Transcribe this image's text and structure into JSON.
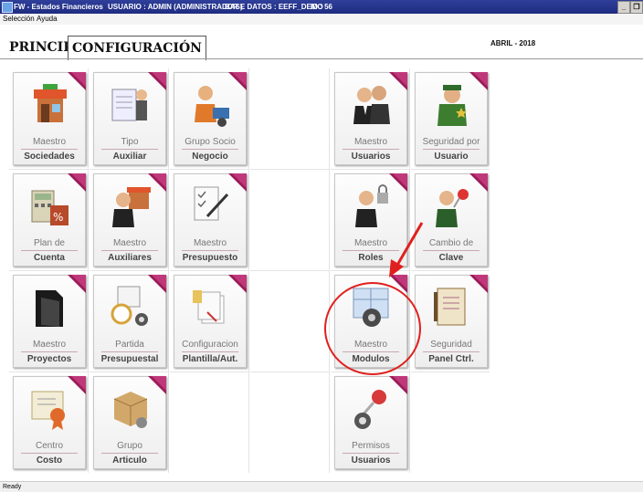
{
  "window": {
    "app_title": "FW - Estados Financieros",
    "user": "USUARIO : ADMIN (ADMINISTRADOR )",
    "database": "BASE DATOS : EEFF_DEMO",
    "id": "ID : 56",
    "minimize_glyph": "_",
    "maximize_glyph": "❐"
  },
  "menu": {
    "items": [
      "Selección",
      "Ayuda"
    ]
  },
  "tabs": [
    "PRINCIPAL",
    "CONFIGURACIÓN"
  ],
  "active_tab": "CONFIGURACIÓN",
  "period": "ABRIL - 2018",
  "tiles": [
    {
      "l1": "Maestro",
      "l2": "Sociedades",
      "icon": "store-icon"
    },
    {
      "l1": "Tipo",
      "l2": "Auxiliar",
      "icon": "document-person-icon"
    },
    {
      "l1": "Grupo Socio",
      "l2": "Negocio",
      "icon": "person-computer-icon"
    },
    {
      "l1": "Maestro",
      "l2": "Usuarios",
      "icon": "users-icon"
    },
    {
      "l1": "Seguridad por",
      "l2": "Usuario",
      "icon": "guard-icon"
    },
    {
      "l1": "Plan de",
      "l2": "Cuenta",
      "icon": "calculator-icon"
    },
    {
      "l1": "Maestro",
      "l2": "Auxiliares",
      "icon": "businessman-store-icon"
    },
    {
      "l1": "Maestro",
      "l2": "Presupuesto",
      "icon": "checklist-pen-icon"
    },
    {
      "l1": "Maestro",
      "l2": "Roles",
      "icon": "person-lock-icon"
    },
    {
      "l1": "Cambio de",
      "l2": "Clave",
      "icon": "person-key-icon"
    },
    {
      "l1": "Maestro",
      "l2": "Proyectos",
      "icon": "folder-icon"
    },
    {
      "l1": "Partida",
      "l2": "Presupuestal",
      "icon": "clock-gear-icon"
    },
    {
      "l1": "Configuracion",
      "l2": "Plantilla/Aut.",
      "icon": "documents-stamp-icon"
    },
    {
      "l1": "Maestro",
      "l2": "Modulos",
      "icon": "window-gear-icon"
    },
    {
      "l1": "Seguridad",
      "l2": "Panel Ctrl.",
      "icon": "notebook-icon"
    },
    {
      "l1": "Centro",
      "l2": "Costo",
      "icon": "certificate-icon"
    },
    {
      "l1": "Grupo",
      "l2": "Articulo",
      "icon": "box-gears-icon"
    },
    {
      "l1": "Permisos",
      "l2": "Usuarios",
      "icon": "keys-gear-icon"
    }
  ],
  "status": "Ready",
  "colors": {
    "titlebar": "#1e2c80",
    "annotation": "#e0201e",
    "corner": "#9b1c59"
  }
}
